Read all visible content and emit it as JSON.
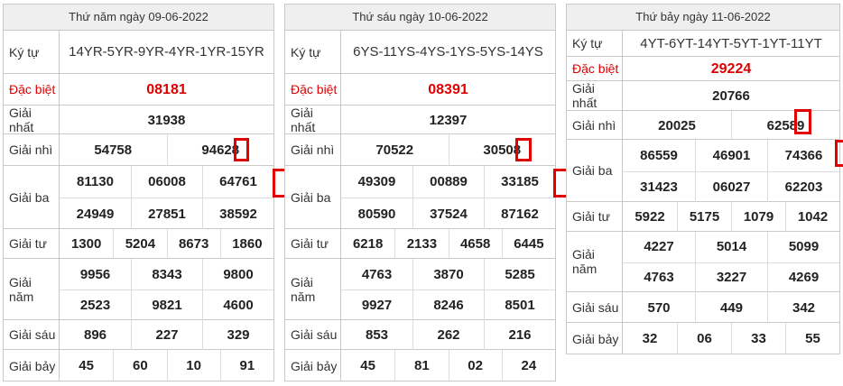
{
  "days": [
    {
      "title": "Thứ năm ngày 09-06-2022",
      "kytu": "14YR-5YR-9YR-4YR-1YR-15YR",
      "dacbiet": "08181",
      "nhat": "31938",
      "nhi": [
        "54758",
        "94628"
      ],
      "ba": [
        "81130",
        "06008",
        "64761",
        "24949",
        "27851",
        "38592"
      ],
      "tu": [
        "1300",
        "5204",
        "8673",
        "1860"
      ],
      "nam": [
        "9956",
        "8343",
        "9800",
        "2523",
        "9821",
        "4600"
      ],
      "sau": [
        "896",
        "227",
        "329"
      ],
      "bay": [
        "45",
        "60",
        "10",
        "91"
      ]
    },
    {
      "title": "Thứ sáu ngày 10-06-2022",
      "kytu": "6YS-11YS-4YS-1YS-5YS-14YS",
      "dacbiet": "08391",
      "nhat": "12397",
      "nhi": [
        "70522",
        "30508"
      ],
      "ba": [
        "49309",
        "00889",
        "33185",
        "80590",
        "37524",
        "87162"
      ],
      "tu": [
        "6218",
        "2133",
        "4658",
        "6445"
      ],
      "nam": [
        "4763",
        "3870",
        "5285",
        "9927",
        "8246",
        "8501"
      ],
      "sau": [
        "853",
        "262",
        "216"
      ],
      "bay": [
        "45",
        "81",
        "02",
        "24"
      ]
    },
    {
      "title": "Thứ bảy ngày 11-06-2022",
      "kytu": "4YT-6YT-14YT-5YT-1YT-11YT",
      "dacbiet": "29224",
      "nhat": "20766",
      "nhi": [
        "20025",
        "62589"
      ],
      "ba": [
        "86559",
        "46901",
        "74366",
        "31423",
        "06027",
        "62203"
      ],
      "tu": [
        "5922",
        "5175",
        "1079",
        "1042"
      ],
      "nam": [
        "4227",
        "5014",
        "5099",
        "4763",
        "3227",
        "4269"
      ],
      "sau": [
        "570",
        "449",
        "342"
      ],
      "bay": [
        "32",
        "06",
        "33",
        "55"
      ]
    }
  ],
  "labels": {
    "kytu": "Ký tự",
    "dacbiet": "Đặc biệt",
    "nhat": "Giải nhất",
    "nhi": "Giải nhì",
    "ba": "Giải ba",
    "tu": "Giải tư",
    "nam": "Giải năm",
    "sau": "Giải sáu",
    "bay": "Giải bảy"
  },
  "colors": {
    "special": "#e00000",
    "highlight": "#e00000",
    "header_bg": "#efefef",
    "border": "#c9c9c9"
  }
}
